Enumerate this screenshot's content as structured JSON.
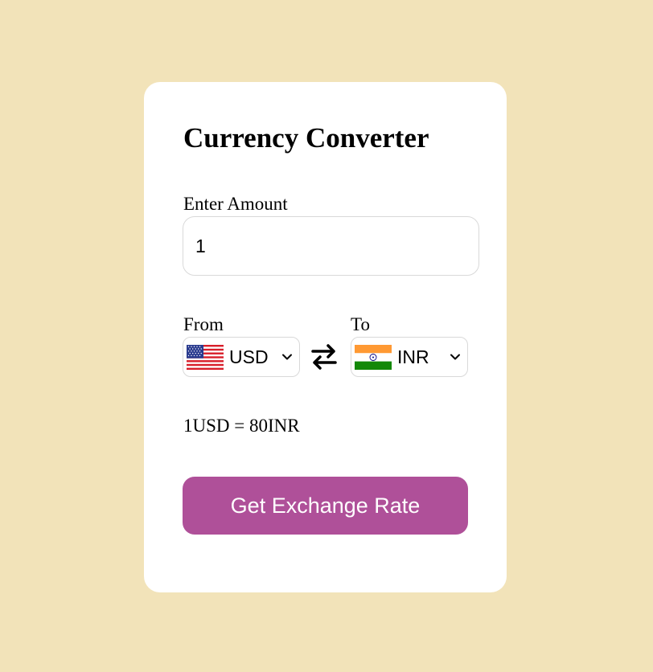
{
  "converter": {
    "title": "Currency Converter",
    "amount_label": "Enter Amount",
    "amount_value": "1",
    "from_label": "From",
    "to_label": "To",
    "from_currency": "USD",
    "to_currency": "INR",
    "from_flag": "us-flag-icon",
    "to_flag": "india-flag-icon",
    "swap_icon": "swap-arrows-icon",
    "rate_text": "1USD = 80INR",
    "button_label": "Get Exchange Rate"
  },
  "colors": {
    "page_background": "#f2e3b9",
    "card_background": "#ffffff",
    "button_background": "#af5099",
    "button_text": "#ffffff",
    "border": "#d9d9d9"
  }
}
